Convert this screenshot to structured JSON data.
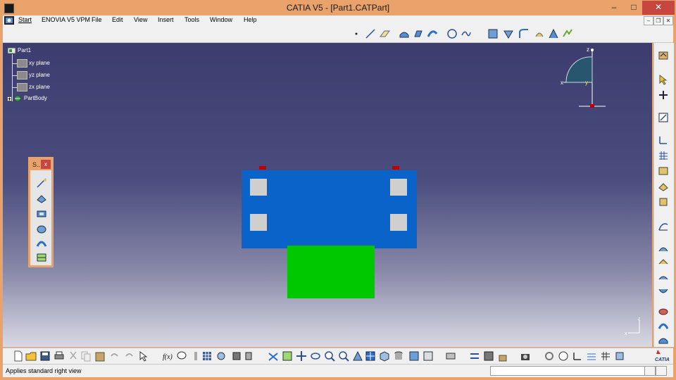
{
  "window": {
    "title": "CATIA V5 - [Part1.CATPart]",
    "controls": {
      "minimize": "–",
      "maximize": "□",
      "close": "✕"
    }
  },
  "menubar": {
    "items": [
      {
        "label": "Start"
      },
      {
        "label": "ENOVIA V5 VPM"
      },
      {
        "label": "File"
      },
      {
        "label": "Edit"
      },
      {
        "label": "View"
      },
      {
        "label": "Insert"
      },
      {
        "label": "Tools"
      },
      {
        "label": "Window"
      },
      {
        "label": "Help"
      }
    ],
    "doc_controls": {
      "minimize": "–",
      "restore": "❐",
      "close": "✕"
    }
  },
  "spec_tree": {
    "root": "Part1",
    "children": [
      {
        "label": "xy plane",
        "icon": "plane-icon"
      },
      {
        "label": "yz plane",
        "icon": "plane-icon"
      },
      {
        "label": "zx plane",
        "icon": "plane-icon"
      },
      {
        "label": "PartBody",
        "icon": "body-icon"
      }
    ]
  },
  "compass": {
    "x_label": "x",
    "y_label": "y",
    "z_label": "z"
  },
  "mini_axis": {
    "x_label": "x",
    "z_label": "z"
  },
  "sketch_toolbar": {
    "title": "S..",
    "close": "x"
  },
  "colors": {
    "part_top": "#0a63c9",
    "part_bottom": "#00c800",
    "hole": "#cfcfcf",
    "marker": "#c00000",
    "viewport_top": "#3c3d6e",
    "viewport_bottom": "#d9d9e4",
    "window_frame": "#e9a26a"
  },
  "brand": {
    "logo_text": "CATIA"
  },
  "status": {
    "message": "Applies standard right view",
    "command_input": ""
  }
}
